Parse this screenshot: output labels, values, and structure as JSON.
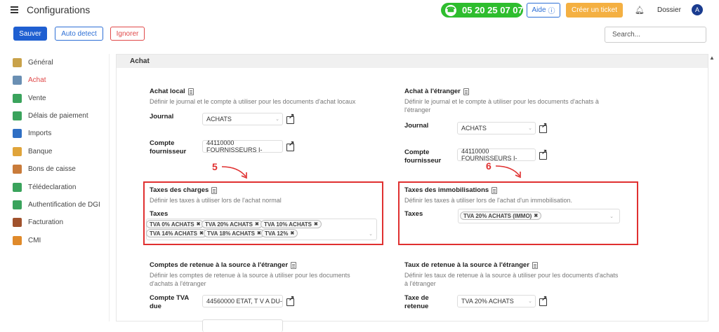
{
  "header": {
    "title": "Configurations",
    "phone": "05 20 25 07 07",
    "aide": "Aide",
    "ticket": "Créer un ticket",
    "dossier": "Dossier",
    "avatar": "A"
  },
  "toolbar": {
    "save": "Sauver",
    "auto": "Auto detect",
    "ignore": "Ignorer",
    "search_placeholder": "Search..."
  },
  "sidebar": {
    "items": [
      {
        "label": "Général",
        "color": "#c9a24a"
      },
      {
        "label": "Achat",
        "color": "#6a8fb3"
      },
      {
        "label": "Vente",
        "color": "#3aa35c"
      },
      {
        "label": "Délais de paiement",
        "color": "#3aa35c"
      },
      {
        "label": "Imports",
        "color": "#2f6fc4"
      },
      {
        "label": "Banque",
        "color": "#e0a43a"
      },
      {
        "label": "Bons de caisse",
        "color": "#c97b3a"
      },
      {
        "label": "Télédeclaration",
        "color": "#3aa35c"
      },
      {
        "label": "Authentification de DGI",
        "color": "#3aa35c"
      },
      {
        "label": "Facturation",
        "color": "#a0522d"
      },
      {
        "label": "CMI",
        "color": "#e08a2a"
      }
    ]
  },
  "section": {
    "title": "Achat"
  },
  "achat_local": {
    "title": "Achat local",
    "desc": "Définir le journal et le compte à utiliser pour les documents d'achat locaux",
    "journal_label": "Journal",
    "journal_value": "ACHATS",
    "compte_label_1": "Compte",
    "compte_label_2": "fournisseur",
    "compte_value": "44110000 FOURNISSEURS I-"
  },
  "achat_etranger": {
    "title": "Achat à l'étranger",
    "desc_1": "Définir le journal et le compte à utiliser pour les documents d'achats à",
    "desc_2": "l'étranger",
    "journal_label": "Journal",
    "journal_value": "ACHATS",
    "compte_label_1": "Compte",
    "compte_label_2": "fournisseur",
    "compte_value": "44110000 FOURNISSEURS I-"
  },
  "taxes_charges": {
    "annotation": "5",
    "title": "Taxes des charges",
    "desc": "Définir les taxes à utiliser lors de l'achat normal",
    "taxes_label": "Taxes",
    "tags": [
      "TVA 0% ACHATS",
      "TVA 20% ACHATS",
      "TVA 10% ACHATS",
      "TVA 14% ACHATS",
      "TVA 18% ACHATS",
      "TVA 12%"
    ]
  },
  "taxes_immo": {
    "annotation": "6",
    "title": "Taxes des immobilisations",
    "desc": "Définir les taxes à utiliser lors de l'achat d'un immobilisation.",
    "taxes_label": "Taxes",
    "tags": [
      "TVA 20% ACHATS (IMMO)"
    ]
  },
  "retenue_comptes": {
    "title": "Comptes de retenue à la source à l'étranger",
    "desc_1": "Définir les comptes de retenue à la source à utiliser pour les documents",
    "desc_2": "d'achats à l'étranger",
    "label_1": "Compte TVA",
    "label_2": "due",
    "value": "44560000 ETAT, T V A DU-"
  },
  "retenue_taux": {
    "title": "Taux de retenue à la source à l'étranger",
    "desc_1": "Définir les taux de retenue à la source à utiliser pour les documents d'achats",
    "desc_2": "à l'étranger",
    "label_1": "Taxe de",
    "label_2": "retenue",
    "value": "TVA 20% ACHATS"
  },
  "colors": {
    "accent": "#1f5fd1",
    "annotation": "#e03030",
    "phone": "#2ebd2e",
    "ticket": "#f4b042"
  }
}
